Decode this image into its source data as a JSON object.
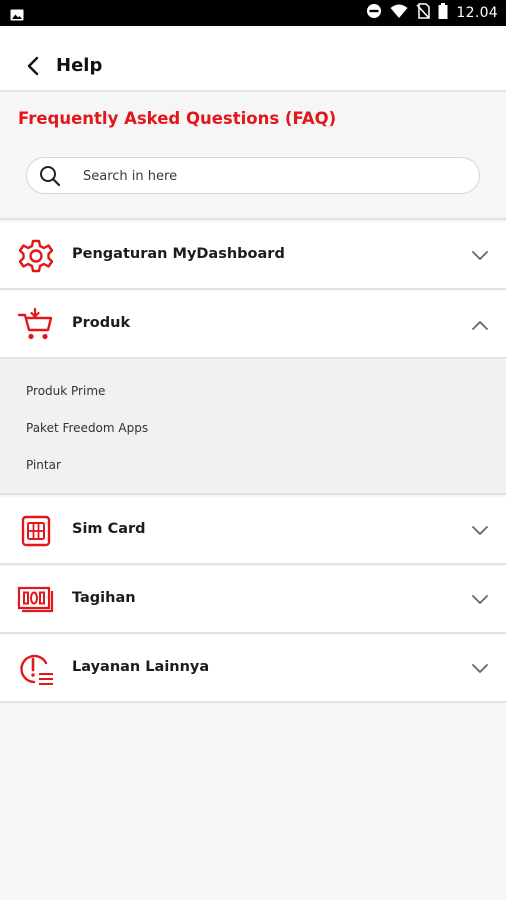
{
  "status_bar": {
    "time": "12.04",
    "icons": [
      "image-icon",
      "do-not-disturb-icon",
      "wifi-icon",
      "no-sim-icon",
      "battery-icon"
    ]
  },
  "header": {
    "back_icon": "chevron-left-icon",
    "title": "Help"
  },
  "faq": {
    "title": "Frequently Asked Questions (FAQ)",
    "search_placeholder": "Search in here"
  },
  "categories": [
    {
      "label": "Pengaturan MyDashboard",
      "icon": "gear-icon",
      "expanded": false
    },
    {
      "label": "Produk",
      "icon": "cart-icon",
      "expanded": true,
      "items": [
        {
          "label": "Produk Prime"
        },
        {
          "label": "Paket Freedom Apps"
        },
        {
          "label": "Pintar"
        }
      ]
    },
    {
      "label": "Sim Card",
      "icon": "sim-card-icon",
      "expanded": false
    },
    {
      "label": "Tagihan",
      "icon": "bill-icon",
      "expanded": false
    },
    {
      "label": "Layanan Lainnya",
      "icon": "other-services-icon",
      "expanded": false
    }
  ],
  "colors": {
    "accent": "#e3161b",
    "background": "#f6f6f6",
    "status_bar": "#000000"
  }
}
